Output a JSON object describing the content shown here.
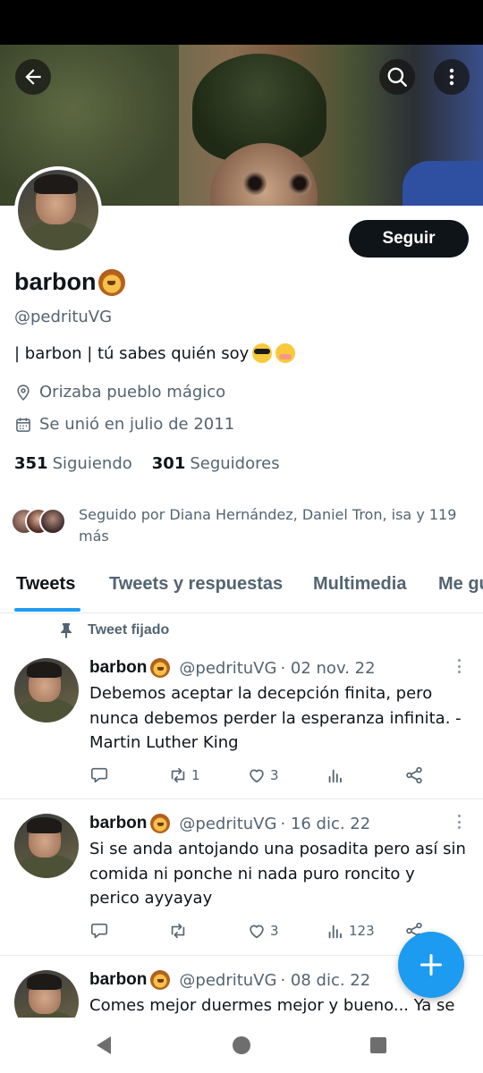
{
  "header": {
    "back_icon": "arrow-left-icon",
    "search_icon": "search-icon",
    "more_icon": "more-vertical-icon"
  },
  "profile": {
    "display_name": "barbon",
    "name_emoji": "lion-emoji",
    "handle": "@pedrituVG",
    "bio": "| barbon | tú sabes quién soy",
    "bio_emojis": [
      "smiling-face-with-sunglasses-emoji",
      "face-with-hand-over-mouth-emoji"
    ],
    "location": "Orizaba pueblo mágico",
    "joined": "Se unió en julio de 2011",
    "following_count": "351",
    "following_label": "Siguiendo",
    "followers_count": "301",
    "followers_label": "Seguidores",
    "follow_button": "Seguir",
    "followed_by": "Seguido por Diana Hernández, Daniel Tron, isa y 119 más"
  },
  "tabs": [
    {
      "label": "Tweets",
      "active": true
    },
    {
      "label": "Tweets y respuestas",
      "active": false
    },
    {
      "label": "Multimedia",
      "active": false
    },
    {
      "label": "Me gusta",
      "active": false
    }
  ],
  "pinned_label": "Tweet fijado",
  "tweets": [
    {
      "name": "barbon",
      "handle": "@pedrituVG",
      "date": "· 02 nov. 22",
      "text": "Debemos aceptar la decepción finita, pero nunca debemos perder la esperanza infinita. - Martin Luther King",
      "retweets": "1",
      "likes": "3",
      "views": ""
    },
    {
      "name": "barbon",
      "handle": "@pedrituVG",
      "date": "· 16 dic. 22",
      "text": "Si se anda antojando una posadita pero así sin comida ni ponche ni nada puro roncito y perico ayyayay",
      "retweets": "",
      "likes": "3",
      "views": "123"
    },
    {
      "name": "barbon",
      "handle": "@pedrituVG",
      "date": "· 08 dic. 22",
      "text": "Comes mejor duermes mejor y bueno... Ya se"
    }
  ],
  "colors": {
    "accent": "#1d9bf0",
    "text_primary": "#0f1419",
    "text_secondary": "#536471"
  }
}
